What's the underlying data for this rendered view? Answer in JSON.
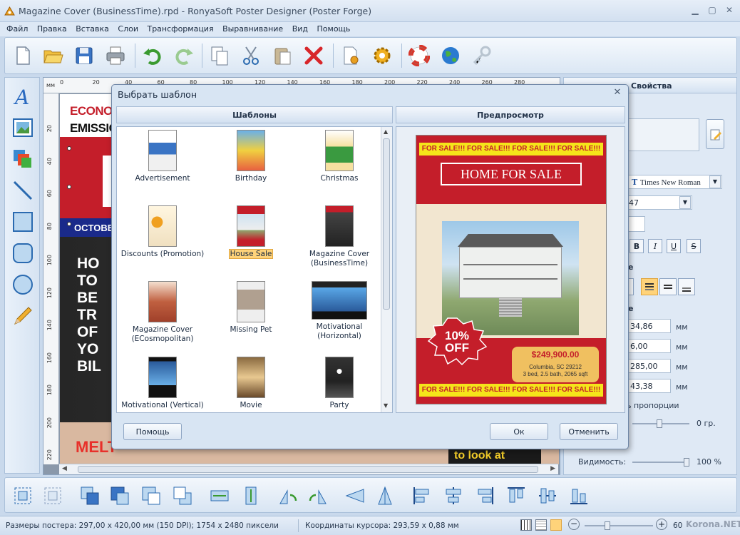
{
  "window": {
    "title": "Magazine Cover (BusinessTime).rpd - RonyaSoft Poster Designer (Poster Forge)"
  },
  "menu": [
    "Файл",
    "Правка",
    "Вставка",
    "Слои",
    "Трансформация",
    "Выравнивание",
    "Вид",
    "Помощь"
  ],
  "ruler": {
    "unit": "мм",
    "top_ticks": [
      "0",
      "20",
      "40",
      "60",
      "80",
      "100",
      "120",
      "140",
      "160",
      "180",
      "200",
      "220",
      "240",
      "260",
      "280"
    ],
    "left_ticks": [
      "20",
      "40",
      "60",
      "80",
      "100",
      "120",
      "140",
      "160",
      "180",
      "200",
      "220"
    ]
  },
  "poster": {
    "headline1": "ECONOMY",
    "headline2": "EMISSION",
    "band": "OCTOBE",
    "lines": [
      "HO",
      "TO",
      "BE",
      "TR",
      "OF",
      "YO",
      "BIL"
    ],
    "bottom_left": "MELT",
    "bottom_right": "to look at"
  },
  "dialog": {
    "title": "Выбрать шаблон",
    "templates_header": "Шаблоны",
    "preview_header": "Предпросмотр",
    "templates": [
      {
        "name": "Advertisement"
      },
      {
        "name": "Birthday"
      },
      {
        "name": "Christmas"
      },
      {
        "name": "Discounts (Promotion)"
      },
      {
        "name": "House Sale",
        "selected": true
      },
      {
        "name": "Magazine Cover (BusinessTime)"
      },
      {
        "name": "Magazine Cover (ECosmopolitan)"
      },
      {
        "name": "Missing Pet"
      },
      {
        "name": "Motivational (Horizontal)"
      },
      {
        "name": "Motivational (Vertical)"
      },
      {
        "name": "Movie"
      },
      {
        "name": "Party"
      }
    ],
    "preview": {
      "banner": "FOR SALE!!! FOR SALE!!! FOR SALE!!! FOR SALE!!!",
      "headline": "HOME FOR SALE",
      "badge_line1": "10%",
      "badge_line2": "OFF",
      "price": "$249,900.00",
      "address": "Columbia, SC 29212",
      "details": "3 bed, 2.5 bath, 2065 sqft"
    },
    "buttons": {
      "help": "Помощь",
      "ok": "Ок",
      "cancel": "Отменить"
    }
  },
  "properties": {
    "title": "Свойства",
    "font": "Times New Roman",
    "size": "47",
    "fields": [
      "34,86",
      "6,00",
      "285,00",
      "43,38"
    ],
    "unit": "мм",
    "keep_proportions": "ь пропорции",
    "section1": "е",
    "section2": "е",
    "rotation": "0 гр.",
    "visibility_label": "Видимость:",
    "visibility_value": "100 %"
  },
  "status": {
    "poster_size": "Размеры постера: 297,00 x 420,00 мм (150 DPI); 1754 x 2480 пиксели",
    "cursor": "Координаты курсора: 293,59 x 0,88 мм",
    "zoom": "60",
    "watermark": "Korona.NET"
  },
  "colors": {
    "accent": "#c41e2a",
    "selection": "#ffd37a",
    "chrome": "#dfe9f5"
  }
}
